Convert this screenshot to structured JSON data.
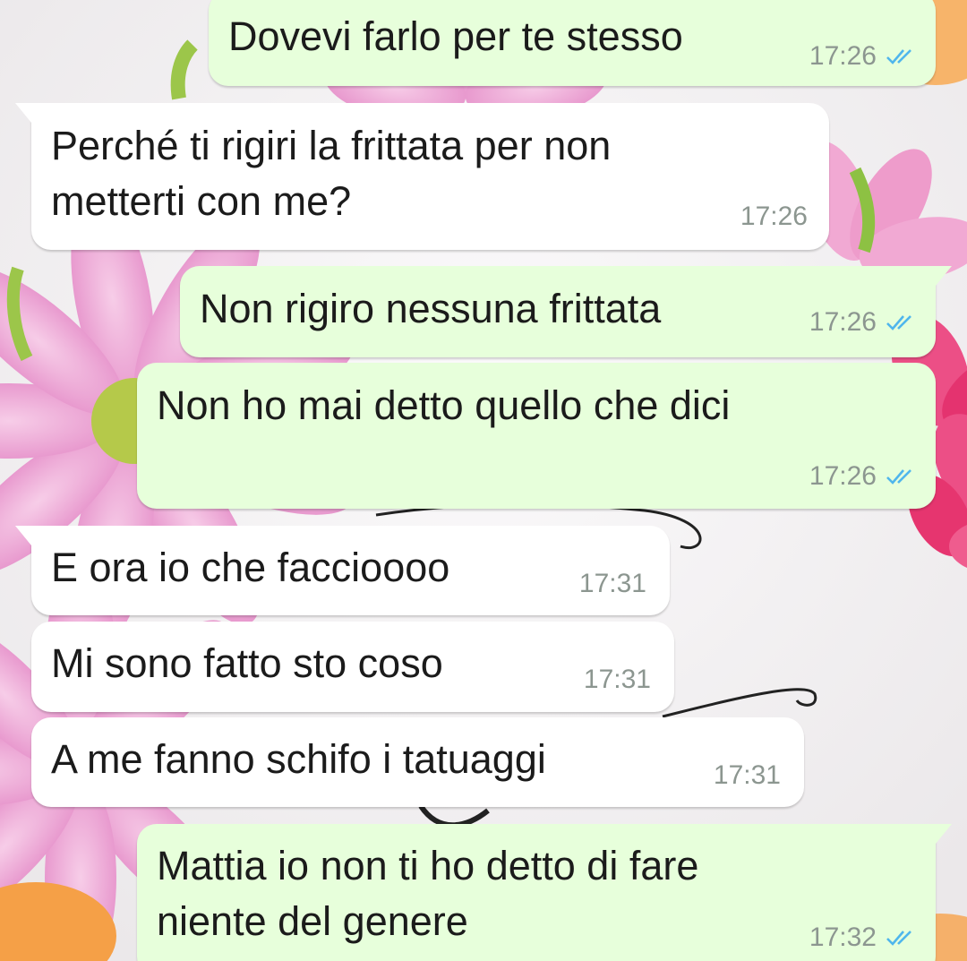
{
  "colors": {
    "incoming_bubble": "#ffffff",
    "outgoing_bubble": "#e7ffdb",
    "text": "#1b1b1b",
    "timestamp": "#8c9690",
    "read_ticks": "#4fb6ec"
  },
  "messages": [
    {
      "direction": "out",
      "text": "Dovevi farlo per te stesso",
      "time": "17:26",
      "status_icon": "double-check-read-icon"
    },
    {
      "direction": "in",
      "text": "Perché ti rigiri la frittata per non\nmetterti con me?",
      "time": "17:26"
    },
    {
      "direction": "out",
      "text": "Non rigiro nessuna frittata",
      "time": "17:26",
      "status_icon": "double-check-read-icon"
    },
    {
      "direction": "out",
      "text": "Non ho mai detto quello che dici",
      "time": "17:26",
      "status_icon": "double-check-read-icon"
    },
    {
      "direction": "in",
      "text": "E ora io che faccioooo",
      "time": "17:31"
    },
    {
      "direction": "in",
      "text": "Mi sono fatto sto coso",
      "time": "17:31"
    },
    {
      "direction": "in",
      "text": "A me fanno schifo i tatuaggi",
      "time": "17:31"
    },
    {
      "direction": "out",
      "text": "Mattia io non ti ho detto di fare\nniente del genere",
      "time": "17:32",
      "status_icon": "double-check-read-icon"
    }
  ]
}
